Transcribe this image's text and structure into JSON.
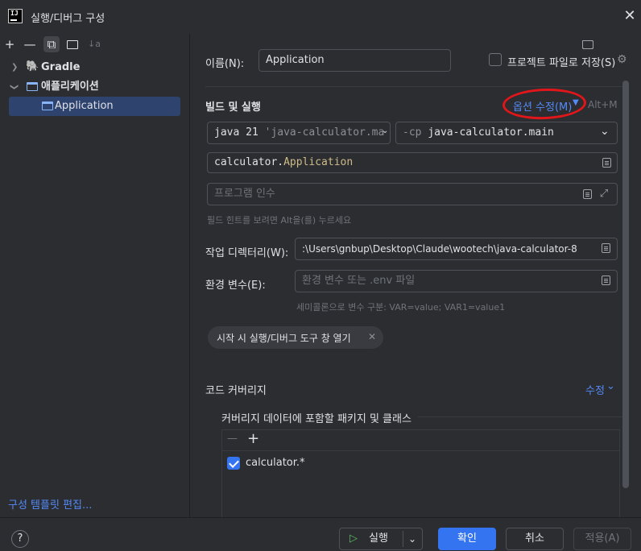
{
  "window": {
    "title": "실행/디버그 구성",
    "app_logo": "IJ"
  },
  "toolbar": {
    "add": "+",
    "remove": "—",
    "copy": "⧉",
    "folder": "📁",
    "sort": "↓a"
  },
  "tree": {
    "gradle": "Gradle",
    "application_group": "애플리케이션",
    "application_item": "Application"
  },
  "sidebar_footer": {
    "edit_templates": "구성 템플릿 편집..."
  },
  "form": {
    "name_label": "이름(N):",
    "name_value": "Application",
    "store_label": "프로젝트 파일로 저장(S)",
    "build_run_label": "빌드 및 실행",
    "modify_options": "옵션 수정(M)",
    "modify_shortcut": "Alt+M",
    "jdk_value_prefix": "java 21",
    "jdk_value_suffix": " 'java-calculator.ma",
    "cp_prefix": "-cp",
    "cp_value": "java-calculator.main",
    "main_class_pkg": "calculator.",
    "main_class_name": "Application",
    "program_args_placeholder": "프로그램 인수",
    "field_hint": "필드 힌트를 보려면 Alt을(를) 누르세요",
    "workdir_label": "작업 디렉터리(W):",
    "workdir_value": ":\\Users\\gnbup\\Desktop\\Claude\\wootech\\java-calculator-8",
    "env_label": "환경 변수(E):",
    "env_placeholder": "환경 변수 또는 .env 파일",
    "env_hint": "세미콜론으로 변수 구분: VAR=value; VAR1=value1",
    "open_tool_window_chip": "시작 시 실행/디버그 도구 창 열기",
    "coverage_label": "코드 커버리지",
    "coverage_modify": "수정",
    "coverage_packages_label": "커버리지 데이터에 포함할 패키지 및 클래스",
    "coverage_entry": "calculator.*"
  },
  "buttons": {
    "help": "?",
    "run": "실행",
    "ok": "확인",
    "cancel": "취소",
    "apply": "적용(A)"
  },
  "colors": {
    "accent": "#3574f0",
    "link": "#548af7",
    "annotation": "#e0161b"
  }
}
